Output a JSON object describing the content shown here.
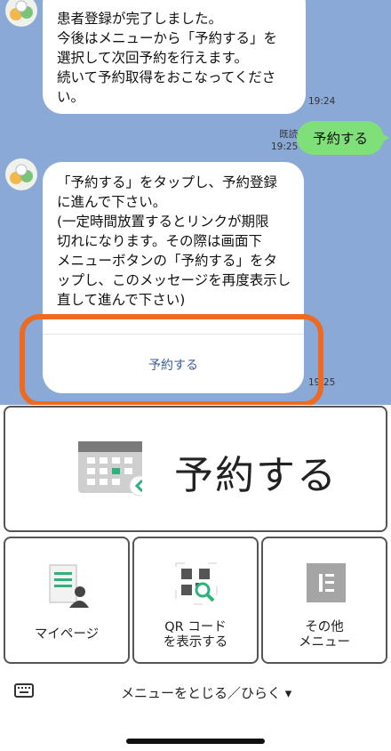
{
  "chat": {
    "message1": [
      "患者登録が完了しました。",
      "今後はメニューから「予約する」を",
      "選択して次回予約を行えます。",
      "続いて予約取得をおこなってくださ",
      "い。"
    ],
    "message1_time": "19:24",
    "read_label": "既読",
    "sent_time": "19:25",
    "sent_message": "予約する",
    "message2": [
      "「予約する」をタップし、予約登録",
      "に進んで下さい。",
      "(一定時間放置するとリンクが期限",
      "切れになります。その際は画面下",
      "メニューボタンの「予約する」をタ",
      "ップし、このメッセージを再度表示し直して進んで下さい)"
    ],
    "message2_action": "予約する",
    "message2_time": "19:25",
    "highlight_color": "#ec6a22"
  },
  "menu": {
    "reserve_label": "予約する",
    "mypage_label": "マイページ",
    "qr_label_line1": "QR コード",
    "qr_label_line2": "を表示する",
    "other_label_line1": "その他",
    "other_label_line2": "メニュー"
  },
  "bottom": {
    "toggle_label": "メニューをとじる／ひらく ▾"
  },
  "icons": [
    "avatar",
    "calendar-icon",
    "mypage-icon",
    "qr-code-icon",
    "menu-icon",
    "keyboard-icon"
  ]
}
